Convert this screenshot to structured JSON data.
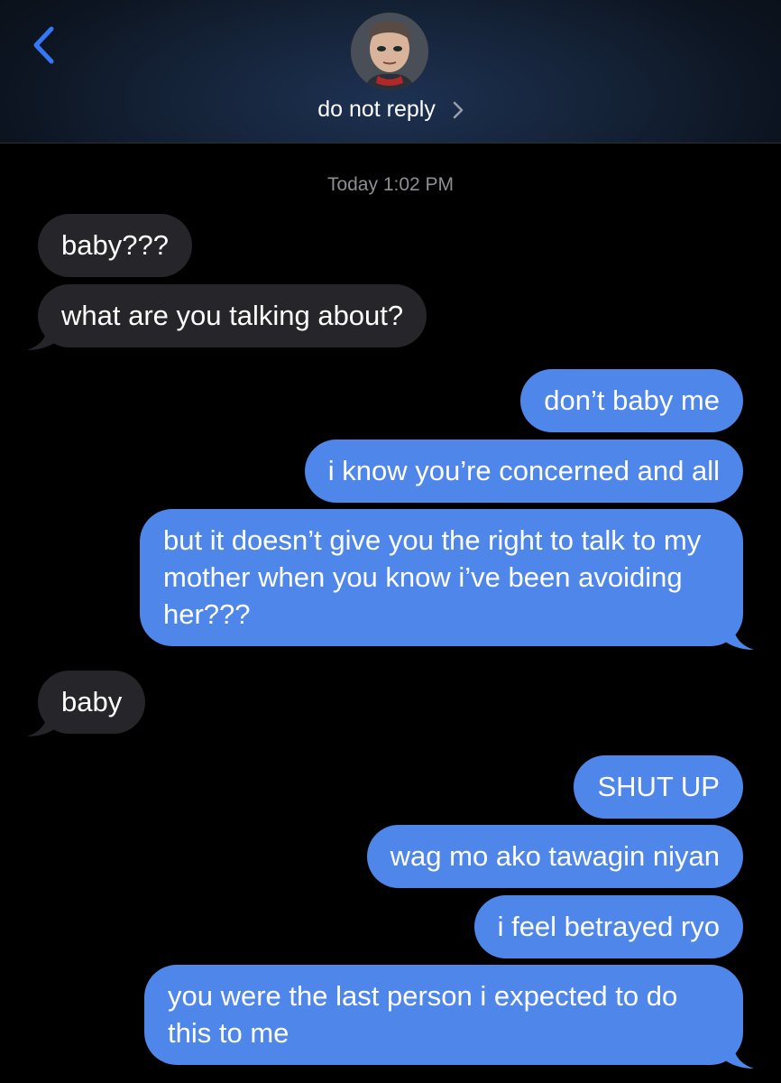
{
  "header": {
    "contact_name": "do not reply",
    "back_icon": "chevron-left-icon",
    "disclosure_icon": "chevron-right-icon",
    "accent_color": "#3478f6"
  },
  "thread": {
    "timestamp": "Today 1:02 PM",
    "messages": [
      {
        "from": "them",
        "text": "baby???"
      },
      {
        "from": "them",
        "text": "what are you talking about?"
      },
      {
        "from": "me",
        "text": "don’t baby me"
      },
      {
        "from": "me",
        "text": "i know you’re concerned and all"
      },
      {
        "from": "me",
        "text": "but it doesn’t give you the right to talk to my mother when you know i’ve been avoiding her???"
      },
      {
        "from": "them",
        "text": "baby"
      },
      {
        "from": "me",
        "text": "SHUT UP"
      },
      {
        "from": "me",
        "text": "wag mo ako tawagin niyan"
      },
      {
        "from": "me",
        "text": "i feel betrayed ryo"
      },
      {
        "from": "me",
        "text": "you were the last person i expected to do this to me"
      }
    ]
  },
  "colors": {
    "incoming_bubble": "#26262a",
    "outgoing_bubble": "#4f86ea",
    "timestamp_text": "#8e8e93"
  }
}
